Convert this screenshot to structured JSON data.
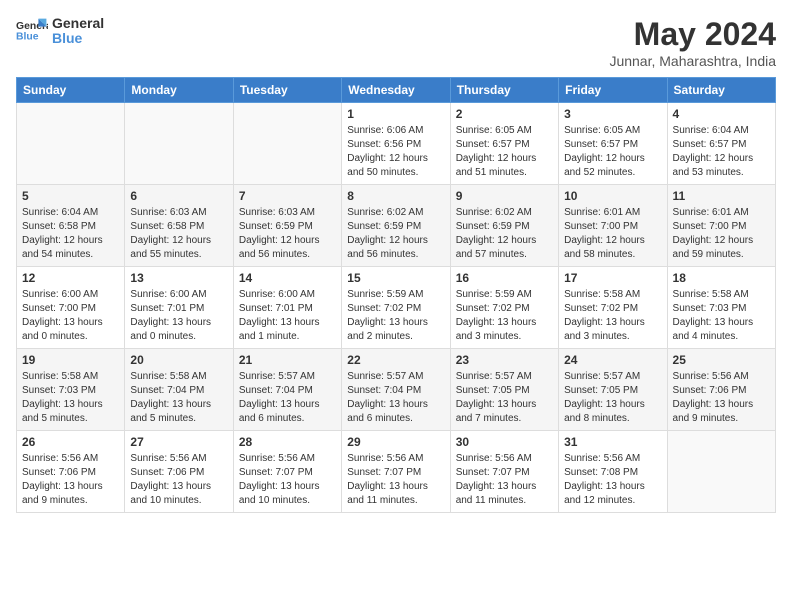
{
  "header": {
    "logo_line1": "General",
    "logo_line2": "Blue",
    "month": "May 2024",
    "location": "Junnar, Maharashtra, India"
  },
  "weekdays": [
    "Sunday",
    "Monday",
    "Tuesday",
    "Wednesday",
    "Thursday",
    "Friday",
    "Saturday"
  ],
  "weeks": [
    [
      {
        "day": "",
        "info": ""
      },
      {
        "day": "",
        "info": ""
      },
      {
        "day": "",
        "info": ""
      },
      {
        "day": "1",
        "info": "Sunrise: 6:06 AM\nSunset: 6:56 PM\nDaylight: 12 hours\nand 50 minutes."
      },
      {
        "day": "2",
        "info": "Sunrise: 6:05 AM\nSunset: 6:57 PM\nDaylight: 12 hours\nand 51 minutes."
      },
      {
        "day": "3",
        "info": "Sunrise: 6:05 AM\nSunset: 6:57 PM\nDaylight: 12 hours\nand 52 minutes."
      },
      {
        "day": "4",
        "info": "Sunrise: 6:04 AM\nSunset: 6:57 PM\nDaylight: 12 hours\nand 53 minutes."
      }
    ],
    [
      {
        "day": "5",
        "info": "Sunrise: 6:04 AM\nSunset: 6:58 PM\nDaylight: 12 hours\nand 54 minutes."
      },
      {
        "day": "6",
        "info": "Sunrise: 6:03 AM\nSunset: 6:58 PM\nDaylight: 12 hours\nand 55 minutes."
      },
      {
        "day": "7",
        "info": "Sunrise: 6:03 AM\nSunset: 6:59 PM\nDaylight: 12 hours\nand 56 minutes."
      },
      {
        "day": "8",
        "info": "Sunrise: 6:02 AM\nSunset: 6:59 PM\nDaylight: 12 hours\nand 56 minutes."
      },
      {
        "day": "9",
        "info": "Sunrise: 6:02 AM\nSunset: 6:59 PM\nDaylight: 12 hours\nand 57 minutes."
      },
      {
        "day": "10",
        "info": "Sunrise: 6:01 AM\nSunset: 7:00 PM\nDaylight: 12 hours\nand 58 minutes."
      },
      {
        "day": "11",
        "info": "Sunrise: 6:01 AM\nSunset: 7:00 PM\nDaylight: 12 hours\nand 59 minutes."
      }
    ],
    [
      {
        "day": "12",
        "info": "Sunrise: 6:00 AM\nSunset: 7:00 PM\nDaylight: 13 hours\nand 0 minutes."
      },
      {
        "day": "13",
        "info": "Sunrise: 6:00 AM\nSunset: 7:01 PM\nDaylight: 13 hours\nand 0 minutes."
      },
      {
        "day": "14",
        "info": "Sunrise: 6:00 AM\nSunset: 7:01 PM\nDaylight: 13 hours\nand 1 minute."
      },
      {
        "day": "15",
        "info": "Sunrise: 5:59 AM\nSunset: 7:02 PM\nDaylight: 13 hours\nand 2 minutes."
      },
      {
        "day": "16",
        "info": "Sunrise: 5:59 AM\nSunset: 7:02 PM\nDaylight: 13 hours\nand 3 minutes."
      },
      {
        "day": "17",
        "info": "Sunrise: 5:58 AM\nSunset: 7:02 PM\nDaylight: 13 hours\nand 3 minutes."
      },
      {
        "day": "18",
        "info": "Sunrise: 5:58 AM\nSunset: 7:03 PM\nDaylight: 13 hours\nand 4 minutes."
      }
    ],
    [
      {
        "day": "19",
        "info": "Sunrise: 5:58 AM\nSunset: 7:03 PM\nDaylight: 13 hours\nand 5 minutes."
      },
      {
        "day": "20",
        "info": "Sunrise: 5:58 AM\nSunset: 7:04 PM\nDaylight: 13 hours\nand 5 minutes."
      },
      {
        "day": "21",
        "info": "Sunrise: 5:57 AM\nSunset: 7:04 PM\nDaylight: 13 hours\nand 6 minutes."
      },
      {
        "day": "22",
        "info": "Sunrise: 5:57 AM\nSunset: 7:04 PM\nDaylight: 13 hours\nand 6 minutes."
      },
      {
        "day": "23",
        "info": "Sunrise: 5:57 AM\nSunset: 7:05 PM\nDaylight: 13 hours\nand 7 minutes."
      },
      {
        "day": "24",
        "info": "Sunrise: 5:57 AM\nSunset: 7:05 PM\nDaylight: 13 hours\nand 8 minutes."
      },
      {
        "day": "25",
        "info": "Sunrise: 5:56 AM\nSunset: 7:06 PM\nDaylight: 13 hours\nand 9 minutes."
      }
    ],
    [
      {
        "day": "26",
        "info": "Sunrise: 5:56 AM\nSunset: 7:06 PM\nDaylight: 13 hours\nand 9 minutes."
      },
      {
        "day": "27",
        "info": "Sunrise: 5:56 AM\nSunset: 7:06 PM\nDaylight: 13 hours\nand 10 minutes."
      },
      {
        "day": "28",
        "info": "Sunrise: 5:56 AM\nSunset: 7:07 PM\nDaylight: 13 hours\nand 10 minutes."
      },
      {
        "day": "29",
        "info": "Sunrise: 5:56 AM\nSunset: 7:07 PM\nDaylight: 13 hours\nand 11 minutes."
      },
      {
        "day": "30",
        "info": "Sunrise: 5:56 AM\nSunset: 7:07 PM\nDaylight: 13 hours\nand 11 minutes."
      },
      {
        "day": "31",
        "info": "Sunrise: 5:56 AM\nSunset: 7:08 PM\nDaylight: 13 hours\nand 12 minutes."
      },
      {
        "day": "",
        "info": ""
      }
    ]
  ]
}
